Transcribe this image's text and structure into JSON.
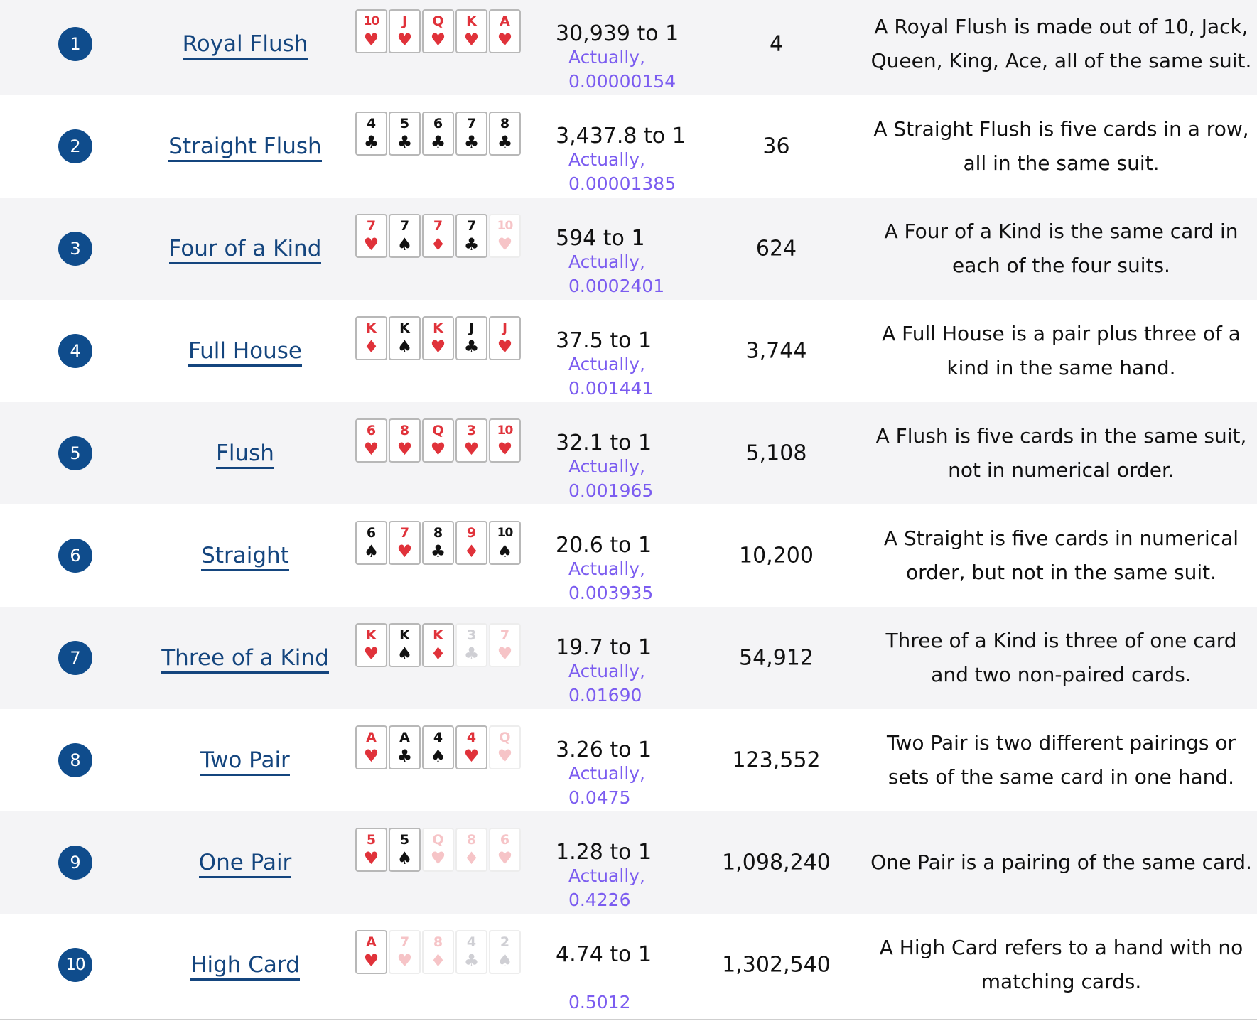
{
  "rows": [
    {
      "rank": "1",
      "name": "Royal Flush",
      "odds": "30,939 to 1",
      "note": [
        "Actually,",
        "0.00000154"
      ],
      "combos": "4",
      "desc": "A Royal Flush is made out of 10, Jack, Queen, King, Ace, all of the same suit.",
      "cards": [
        {
          "rank": "10",
          "suit": "♥",
          "color": "red",
          "faded": false
        },
        {
          "rank": "J",
          "suit": "♥",
          "color": "red",
          "faded": false
        },
        {
          "rank": "Q",
          "suit": "♥",
          "color": "red",
          "faded": false
        },
        {
          "rank": "K",
          "suit": "♥",
          "color": "red",
          "faded": false
        },
        {
          "rank": "A",
          "suit": "♥",
          "color": "red",
          "faded": false
        }
      ]
    },
    {
      "rank": "2",
      "name": "Straight Flush",
      "odds": "3,437.8 to 1",
      "note": [
        "Actually,",
        "0.00001385"
      ],
      "combos": "36",
      "desc": "A Straight Flush is five cards in a row, all in the same suit.",
      "cards": [
        {
          "rank": "4",
          "suit": "♣",
          "color": "black",
          "faded": false
        },
        {
          "rank": "5",
          "suit": "♣",
          "color": "black",
          "faded": false
        },
        {
          "rank": "6",
          "suit": "♣",
          "color": "black",
          "faded": false
        },
        {
          "rank": "7",
          "suit": "♣",
          "color": "black",
          "faded": false
        },
        {
          "rank": "8",
          "suit": "♣",
          "color": "black",
          "faded": false
        }
      ]
    },
    {
      "rank": "3",
      "name": "Four of a Kind",
      "odds": "594 to 1",
      "note": [
        "Actually,",
        "0.0002401"
      ],
      "combos": "624",
      "desc": "A Four of a Kind is the same card in each of the four suits.",
      "cards": [
        {
          "rank": "7",
          "suit": "♥",
          "color": "red",
          "faded": false
        },
        {
          "rank": "7",
          "suit": "♠",
          "color": "black",
          "faded": false
        },
        {
          "rank": "7",
          "suit": "♦",
          "color": "red",
          "faded": false
        },
        {
          "rank": "7",
          "suit": "♣",
          "color": "black",
          "faded": false
        },
        {
          "rank": "10",
          "suit": "♥",
          "color": "red",
          "faded": true
        }
      ]
    },
    {
      "rank": "4",
      "name": "Full House",
      "odds": "37.5 to 1",
      "note": [
        "Actually,",
        "0.001441"
      ],
      "combos": "3,744",
      "desc": "A Full House is a pair plus three of a kind in the same hand.",
      "cards": [
        {
          "rank": "K",
          "suit": "♦",
          "color": "red",
          "faded": false
        },
        {
          "rank": "K",
          "suit": "♠",
          "color": "black",
          "faded": false
        },
        {
          "rank": "K",
          "suit": "♥",
          "color": "red",
          "faded": false
        },
        {
          "rank": "J",
          "suit": "♣",
          "color": "black",
          "faded": false
        },
        {
          "rank": "J",
          "suit": "♥",
          "color": "red",
          "faded": false
        }
      ]
    },
    {
      "rank": "5",
      "name": "Flush",
      "odds": "32.1 to 1",
      "note": [
        "Actually,",
        "0.001965"
      ],
      "combos": "5,108",
      "desc": "A Flush is five cards in the same suit, not in numerical order.",
      "cards": [
        {
          "rank": "6",
          "suit": "♥",
          "color": "red",
          "faded": false
        },
        {
          "rank": "8",
          "suit": "♥",
          "color": "red",
          "faded": false
        },
        {
          "rank": "Q",
          "suit": "♥",
          "color": "red",
          "faded": false
        },
        {
          "rank": "3",
          "suit": "♥",
          "color": "red",
          "faded": false
        },
        {
          "rank": "10",
          "suit": "♥",
          "color": "red",
          "faded": false
        }
      ]
    },
    {
      "rank": "6",
      "name": "Straight",
      "odds": "20.6 to 1",
      "note": [
        "Actually,",
        "0.003935"
      ],
      "combos": "10,200",
      "desc": "A Straight is five cards in numerical order, but not in the same suit.",
      "cards": [
        {
          "rank": "6",
          "suit": "♠",
          "color": "black",
          "faded": false
        },
        {
          "rank": "7",
          "suit": "♥",
          "color": "red",
          "faded": false
        },
        {
          "rank": "8",
          "suit": "♣",
          "color": "black",
          "faded": false
        },
        {
          "rank": "9",
          "suit": "♦",
          "color": "red",
          "faded": false
        },
        {
          "rank": "10",
          "suit": "♠",
          "color": "black",
          "faded": false
        }
      ]
    },
    {
      "rank": "7",
      "name": "Three of a Kind",
      "odds": "19.7 to 1",
      "note": [
        "Actually,",
        "0.01690"
      ],
      "combos": "54,912",
      "desc": "Three of a Kind is three of one card and two non-paired cards.",
      "cards": [
        {
          "rank": "K",
          "suit": "♥",
          "color": "red",
          "faded": false
        },
        {
          "rank": "K",
          "suit": "♠",
          "color": "black",
          "faded": false
        },
        {
          "rank": "K",
          "suit": "♦",
          "color": "red",
          "faded": false
        },
        {
          "rank": "3",
          "suit": "♣",
          "color": "black",
          "faded": true
        },
        {
          "rank": "7",
          "suit": "♥",
          "color": "red",
          "faded": true
        }
      ]
    },
    {
      "rank": "8",
      "name": "Two Pair",
      "odds": "3.26 to 1",
      "note": [
        "Actually,",
        "0.0475"
      ],
      "combos": "123,552",
      "desc": "Two Pair is two different pairings or sets of the same card in one hand.",
      "cards": [
        {
          "rank": "A",
          "suit": "♥",
          "color": "red",
          "faded": false
        },
        {
          "rank": "A",
          "suit": "♣",
          "color": "black",
          "faded": false
        },
        {
          "rank": "4",
          "suit": "♠",
          "color": "black",
          "faded": false
        },
        {
          "rank": "4",
          "suit": "♥",
          "color": "red",
          "faded": false
        },
        {
          "rank": "Q",
          "suit": "♥",
          "color": "red",
          "faded": true
        }
      ]
    },
    {
      "rank": "9",
      "name": "One Pair",
      "odds": "1.28 to 1",
      "note": [
        "Actually,",
        "0.4226"
      ],
      "combos": "1,098,240",
      "desc": "One Pair is a pairing of the same card.",
      "cards": [
        {
          "rank": "5",
          "suit": "♥",
          "color": "red",
          "faded": false
        },
        {
          "rank": "5",
          "suit": "♠",
          "color": "black",
          "faded": false
        },
        {
          "rank": "Q",
          "suit": "♥",
          "color": "red",
          "faded": true
        },
        {
          "rank": "8",
          "suit": "♦",
          "color": "red",
          "faded": true
        },
        {
          "rank": "6",
          "suit": "♥",
          "color": "red",
          "faded": true
        }
      ]
    },
    {
      "rank": "10",
      "name": "High Card",
      "odds": "4.74 to 1",
      "note": [
        "0.5012"
      ],
      "combos": "1,302,540",
      "desc": "A High Card refers to a hand with no matching cards.",
      "cards": [
        {
          "rank": "A",
          "suit": "♥",
          "color": "red",
          "faded": false
        },
        {
          "rank": "7",
          "suit": "♥",
          "color": "red",
          "faded": true
        },
        {
          "rank": "8",
          "suit": "♦",
          "color": "red",
          "faded": true
        },
        {
          "rank": "4",
          "suit": "♣",
          "color": "black",
          "faded": true
        },
        {
          "rank": "2",
          "suit": "♠",
          "color": "black",
          "faded": true
        }
      ]
    }
  ],
  "colors": {
    "rank_badge": "#0f4c8c",
    "link": "#14457e",
    "note": "#7b5cf0",
    "suit_red": "#e0323a",
    "row_alt": "#f4f4f6"
  }
}
